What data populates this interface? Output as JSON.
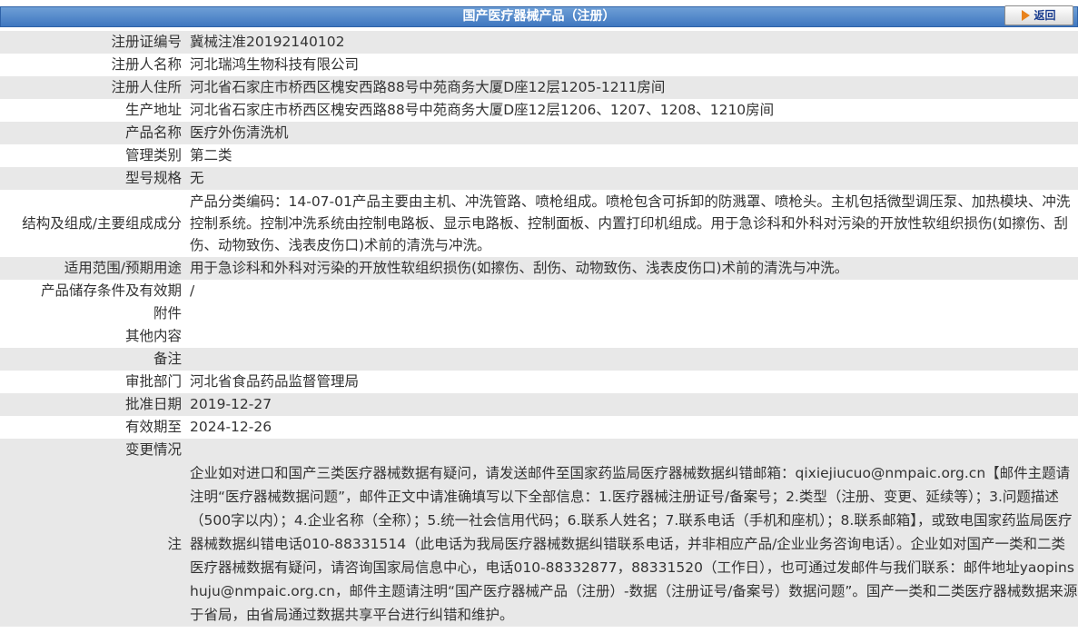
{
  "header": {
    "title": "国产医疗器械产品（注册）",
    "back_label": "返回"
  },
  "rows": [
    {
      "label": "注册证编号",
      "value": "冀械注准20192140102"
    },
    {
      "label": "注册人名称",
      "value": "河北瑞鸿生物科技有限公司"
    },
    {
      "label": "注册人住所",
      "value": "河北省石家庄市桥西区槐安西路88号中苑商务大厦D座12层1205-1211房间"
    },
    {
      "label": "生产地址",
      "value": "河北省石家庄市桥西区槐安西路88号中苑商务大厦D座12层1206、1207、1208、1210房间"
    },
    {
      "label": "产品名称",
      "value": "医疗外伤清洗机"
    },
    {
      "label": "管理类别",
      "value": "第二类"
    },
    {
      "label": "型号规格",
      "value": "无"
    },
    {
      "label": "结构及组成/主要组成成分",
      "value": "产品分类编码：14-07-01产品主要由主机、冲洗管路、喷枪组成。喷枪包含可拆卸的防溅罩、喷枪头。主机包括微型调压泵、加热模块、冲洗控制系统。控制冲洗系统由控制电路板、显示电路板、控制面板、内置打印机组成。用于急诊科和外科对污染的开放性软组织损伤(如擦伤、刮伤、动物致伤、浅表皮伤口)术前的清洗与冲洗。"
    },
    {
      "label": "适用范围/预期用途",
      "value": "用于急诊科和外科对污染的开放性软组织损伤(如擦伤、刮伤、动物致伤、浅表皮伤口)术前的清洗与冲洗。"
    },
    {
      "label": "产品储存条件及有效期",
      "value": "/"
    },
    {
      "label": "附件",
      "value": ""
    },
    {
      "label": "其他内容",
      "value": ""
    },
    {
      "label": "备注",
      "value": ""
    },
    {
      "label": "审批部门",
      "value": "河北省食品药品监督管理局"
    },
    {
      "label": "批准日期",
      "value": "2019-12-27"
    },
    {
      "label": "有效期至",
      "value": "2024-12-26"
    },
    {
      "label": "变更情况",
      "value": ""
    }
  ],
  "note": {
    "label": "注",
    "text": "企业如对进口和国产三类医疗器械数据有疑问，请发送邮件至国家药监局医疗器械数据纠错邮箱：qixiejiucuo@nmpaic.org.cn【邮件主题请注明“医疗器械数据问题”，邮件正文中请准确填写以下全部信息：1.医疗器械注册证号/备案号；2.类型（注册、变更、延续等）；3.问题描述（500字以内）；4.企业名称（全称）；5.统一社会信用代码；6.联系人姓名；7.联系电话（手机和座机）；8.联系邮箱】，或致电国家药监局医疗器械数据纠错电话010-88331514（此电话为我局医疗器械数据纠错联系电话，并非相应产品/企业业务咨询电话）。企业如对国产一类和二类医疗器械数据有疑问，请咨询国家局信息中心，电话010-88332877，88331520（工作日），也可通过发邮件与我们联系：邮件地址yaopinshuju@nmpaic.org.cn，邮件主题请注明“国产医疗器械产品（注册）-数据（注册证号/备案号）数据问题”。国产一类和二类医疗器械数据来源于省局，由省局通过数据共享平台进行纠错和维护。"
  },
  "colors": {
    "header_bar": "#4a80c6",
    "row_gray": "#e8e8e8",
    "row_white": "#ffffff",
    "back_arrow": "#e8821c"
  }
}
